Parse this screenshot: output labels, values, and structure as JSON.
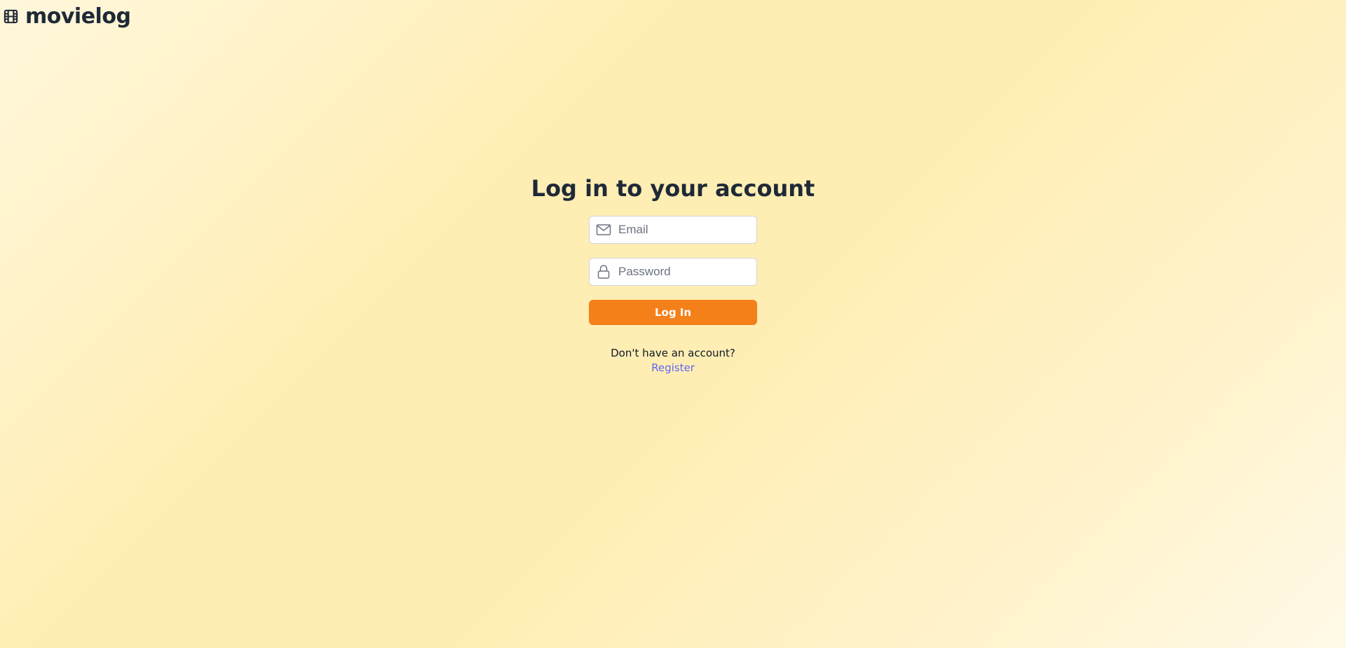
{
  "brand": {
    "name": "movielog",
    "icon": "film-icon"
  },
  "login": {
    "title": "Log in to your account",
    "email": {
      "placeholder": "Email",
      "value": "",
      "icon": "envelope-icon"
    },
    "password": {
      "placeholder": "Password",
      "value": "",
      "icon": "lock-icon"
    },
    "submit_label": "Log In",
    "register_prompt": "Don't have an account?",
    "register_link": "Register"
  },
  "colors": {
    "accent": "#f4801a",
    "link": "#6366f1",
    "text": "#1f2937",
    "background": "#ffeeb3"
  }
}
